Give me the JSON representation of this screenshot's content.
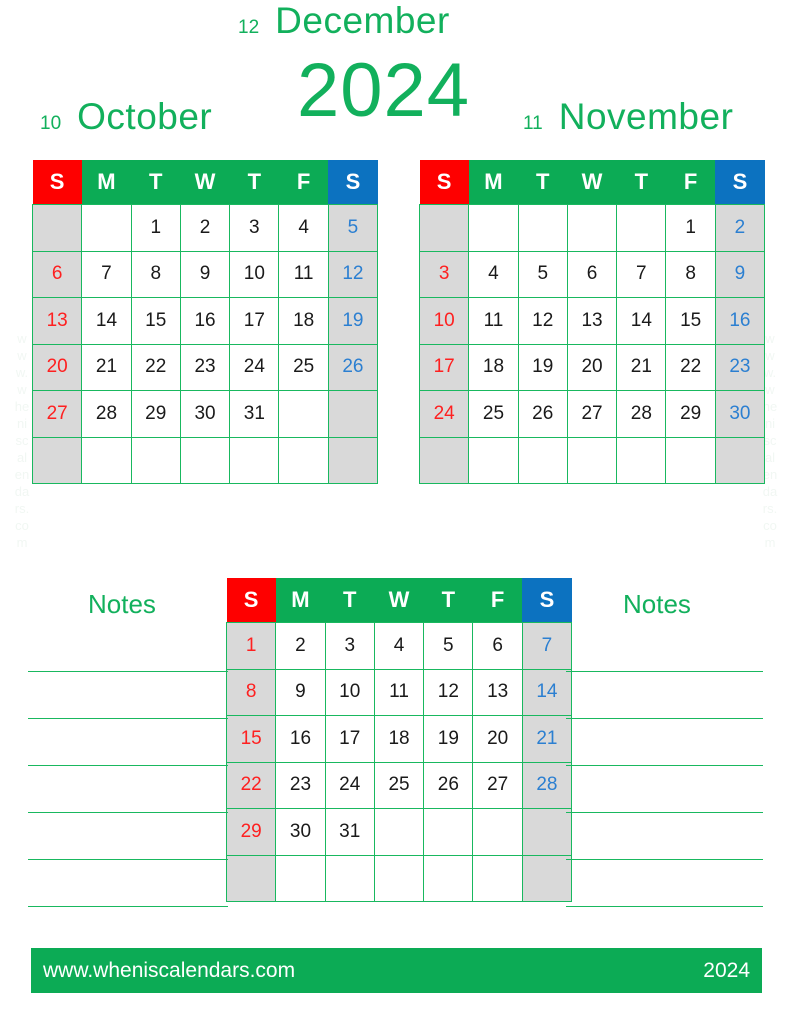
{
  "page": {
    "year_big": "2024",
    "watermark_text": "www.wheniscalendars.com"
  },
  "weekday_headers": [
    "S",
    "M",
    "T",
    "W",
    "T",
    "F",
    "S"
  ],
  "months": [
    {
      "number": "10",
      "name": "October",
      "weeks": [
        [
          "",
          "",
          "1",
          "2",
          "3",
          "4",
          "5"
        ],
        [
          "6",
          "7",
          "8",
          "9",
          "10",
          "11",
          "12"
        ],
        [
          "13",
          "14",
          "15",
          "16",
          "17",
          "18",
          "19"
        ],
        [
          "20",
          "21",
          "22",
          "23",
          "24",
          "25",
          "26"
        ],
        [
          "27",
          "28",
          "29",
          "30",
          "31",
          "",
          ""
        ],
        [
          "",
          "",
          "",
          "",
          "",
          "",
          ""
        ]
      ]
    },
    {
      "number": "11",
      "name": "November",
      "weeks": [
        [
          "",
          "",
          "",
          "",
          "",
          "1",
          "2"
        ],
        [
          "3",
          "4",
          "5",
          "6",
          "7",
          "8",
          "9"
        ],
        [
          "10",
          "11",
          "12",
          "13",
          "14",
          "15",
          "16"
        ],
        [
          "17",
          "18",
          "19",
          "20",
          "21",
          "22",
          "23"
        ],
        [
          "24",
          "25",
          "26",
          "27",
          "28",
          "29",
          "30"
        ],
        [
          "",
          "",
          "",
          "",
          "",
          "",
          ""
        ]
      ]
    },
    {
      "number": "12",
      "name": "December",
      "weeks": [
        [
          "1",
          "2",
          "3",
          "4",
          "5",
          "6",
          "7"
        ],
        [
          "8",
          "9",
          "10",
          "11",
          "12",
          "13",
          "14"
        ],
        [
          "15",
          "16",
          "17",
          "18",
          "19",
          "20",
          "21"
        ],
        [
          "22",
          "23",
          "24",
          "25",
          "26",
          "27",
          "28"
        ],
        [
          "29",
          "30",
          "31",
          "",
          "",
          "",
          ""
        ],
        [
          "",
          "",
          "",
          "",
          "",
          "",
          ""
        ]
      ]
    }
  ],
  "notes": {
    "left_label": "Notes",
    "right_label": "Notes",
    "line_count": 6
  },
  "footer": {
    "site": "www.wheniscalendars.com",
    "year": "2024"
  },
  "colors": {
    "green": "#0cab55",
    "green_text": "#12b05c",
    "grid": "#19b85f",
    "sunday_red": "#fe0000",
    "saturday_blue": "#0c72c0",
    "weekend_cell": "#d9d9d9",
    "sunday_num": "#fe2020",
    "saturday_num": "#2b7fd1"
  }
}
